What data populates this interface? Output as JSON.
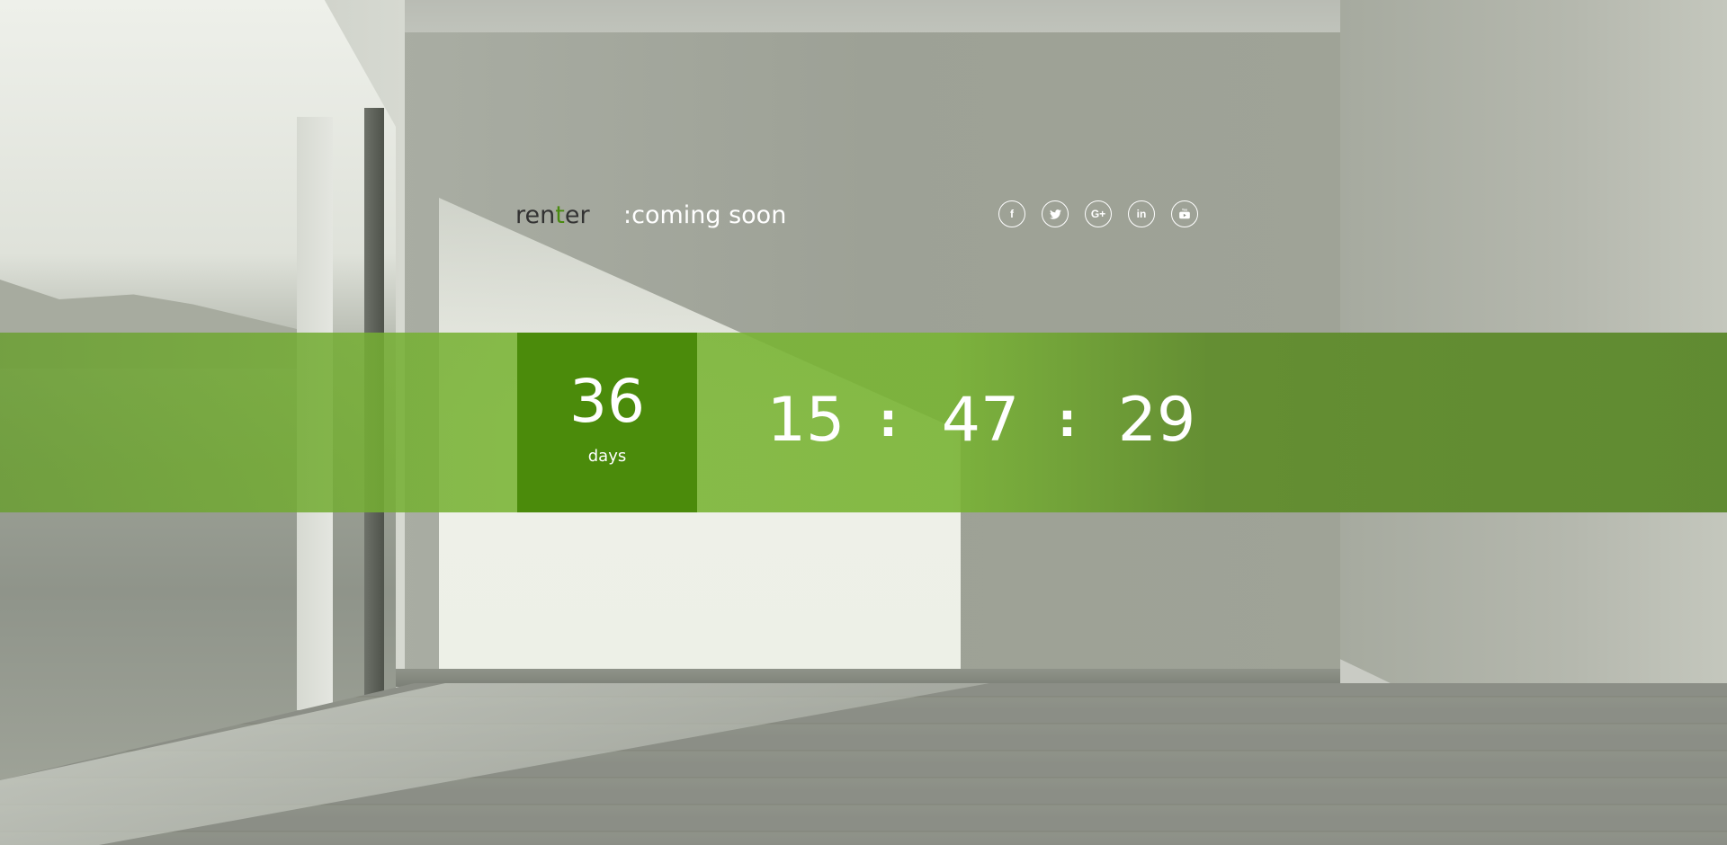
{
  "header": {
    "brand": {
      "prefix": "ren",
      "accent": "t",
      "suffix": "er"
    },
    "tagline": ":coming soon"
  },
  "social": [
    {
      "icon": "facebook-icon",
      "glyph": "f"
    },
    {
      "icon": "twitter-icon",
      "glyph": "t"
    },
    {
      "icon": "google-plus-icon",
      "glyph": "G+"
    },
    {
      "icon": "linkedin-icon",
      "glyph": "in"
    },
    {
      "icon": "youtube-icon",
      "glyph": "You"
    }
  ],
  "countdown": {
    "days": "36",
    "days_label": "days",
    "hours": "15",
    "minutes": "47",
    "seconds": "29",
    "separator": ":"
  },
  "colors": {
    "accent_green": "#4b8b0b",
    "band_green": "#79b434",
    "text_white": "#ffffff",
    "brand_dark": "#333333"
  }
}
